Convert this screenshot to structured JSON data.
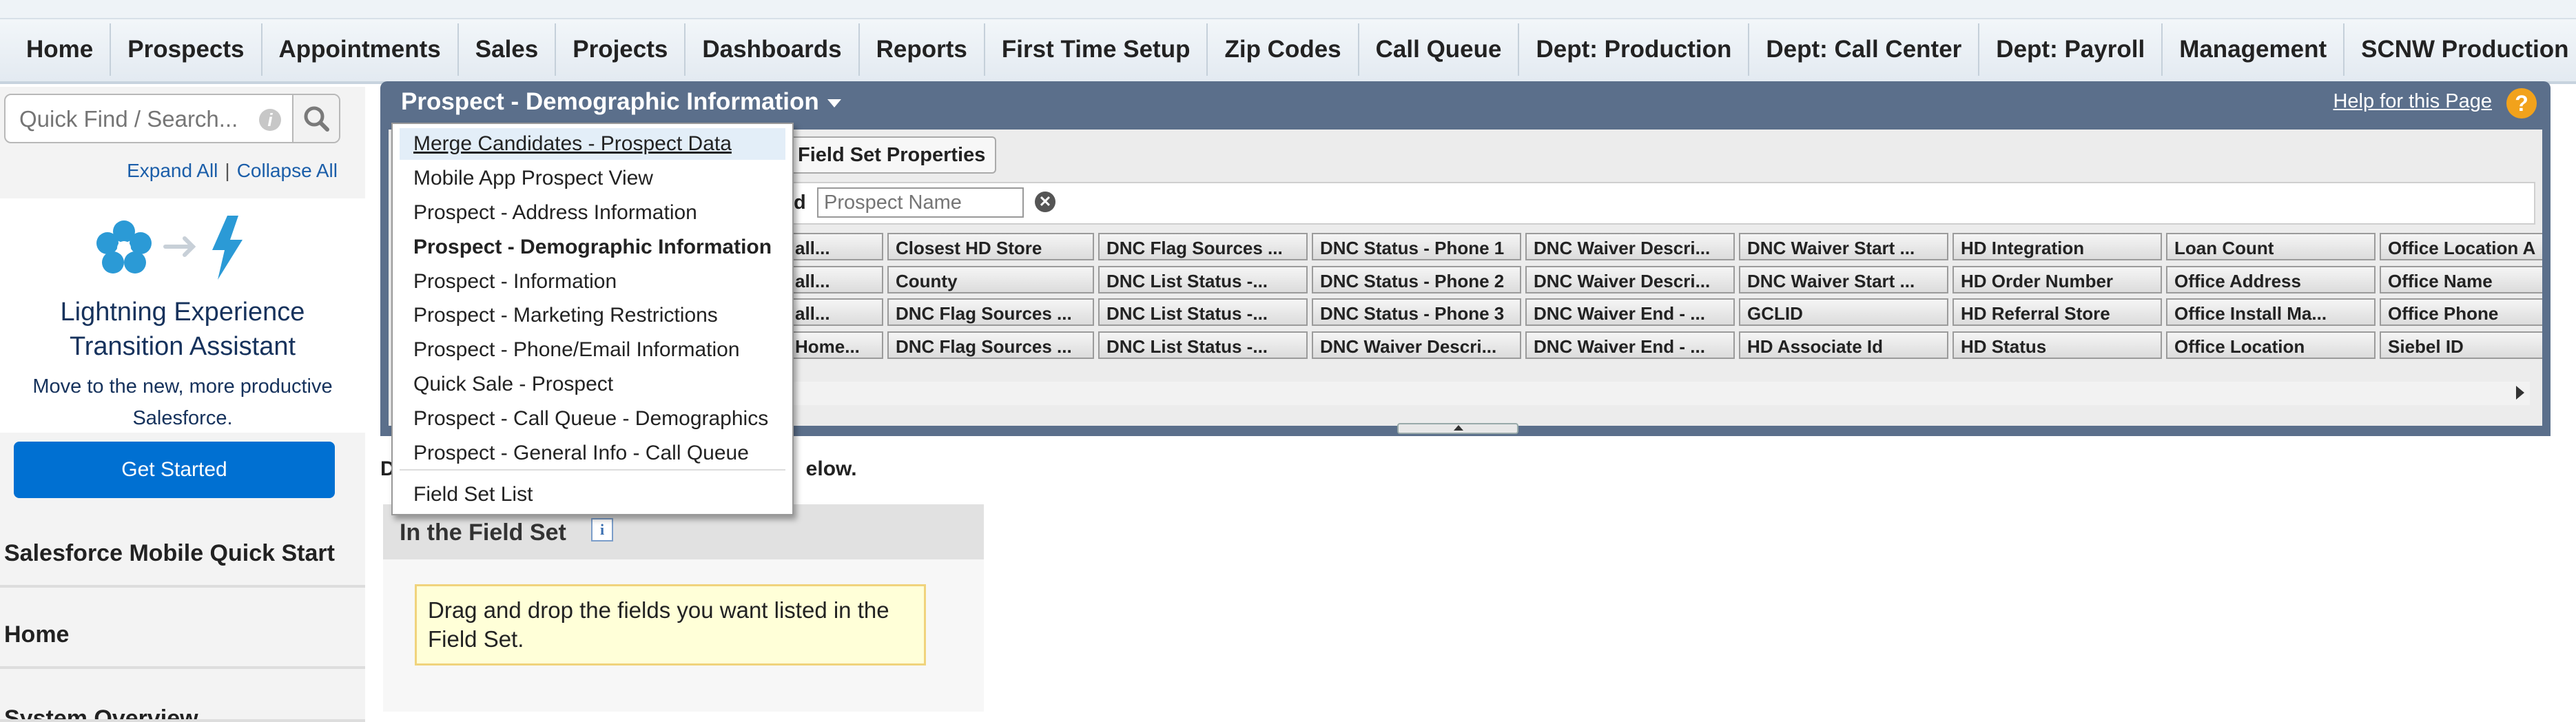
{
  "tabs": [
    "Home",
    "Prospects",
    "Appointments",
    "Sales",
    "Projects",
    "Dashboards",
    "Reports",
    "First Time Setup",
    "Zip Codes",
    "Call Queue",
    "Dept: Production",
    "Dept: Call Center",
    "Dept: Payroll",
    "Management",
    "SCNW Production",
    "✚"
  ],
  "sidebar": {
    "search_placeholder": "Quick Find / Search...",
    "expand_all": "Expand All",
    "separator": "|",
    "collapse_all": "Collapse All",
    "lightning_title": "Lightning Experience Transition Assistant",
    "lightning_desc": "Move to the new, more productive Salesforce.",
    "get_started": "Get Started",
    "items": [
      "Salesforce Mobile Quick Start",
      "Home",
      "System Overview"
    ]
  },
  "panel": {
    "title": "Prospect - Demographic Information",
    "help": "Help for this Page",
    "field_set_properties": "Field Set Properties",
    "quick_find_label": "d",
    "quick_find_placeholder": "Prospect Name"
  },
  "field_grid": [
    [
      "all...",
      "Closest HD Store",
      "DNC Flag Sources ...",
      "DNC Status - Phone 1",
      "DNC Waiver Descri...",
      "DNC Waiver Start ...",
      "HD Integration",
      "Loan Count",
      "Office Location A"
    ],
    [
      "all...",
      "County",
      "DNC List Status -...",
      "DNC Status - Phone 2",
      "DNC Waiver Descri...",
      "DNC Waiver Start ...",
      "HD Order Number",
      "Office Address",
      "Office Name"
    ],
    [
      "all...",
      "DNC Flag Sources ...",
      "DNC List Status -...",
      "DNC Status - Phone 3",
      "DNC Waiver End - ...",
      "GCLID",
      "HD Referral Store",
      "Office Install Ma...",
      "Office Phone"
    ],
    [
      "Home...",
      "DNC Flag Sources ...",
      "DNC List Status -...",
      "DNC Waiver Descri...",
      "DNC Waiver End - ...",
      "HD Associate Id",
      "HD Status",
      "Office Location",
      "Siebel ID"
    ]
  ],
  "below_text": "elow.",
  "below_prefix": "D",
  "in_field_set": {
    "title": "In the Field Set",
    "message": "Drag and drop the fields you want listed in the Field Set."
  },
  "menu": {
    "items": [
      "Merge Candidates - Prospect Data",
      "Mobile App Prospect View",
      "Prospect - Address Information",
      "Prospect - Demographic Information",
      "Prospect - Information",
      "Prospect - Marketing Restrictions",
      "Prospect - Phone/Email Information",
      "Quick Sale - Prospect",
      "Prospect - Call Queue - Demographics",
      "Prospect - General Info - Call Queue"
    ],
    "selected_index": 3,
    "highlighted_index": 0,
    "footer": "Field Set List"
  },
  "colors": {
    "panel_header": "#5b6f8b",
    "lightning_blue": "#0070d2",
    "help_icon": "#f2a21b"
  }
}
